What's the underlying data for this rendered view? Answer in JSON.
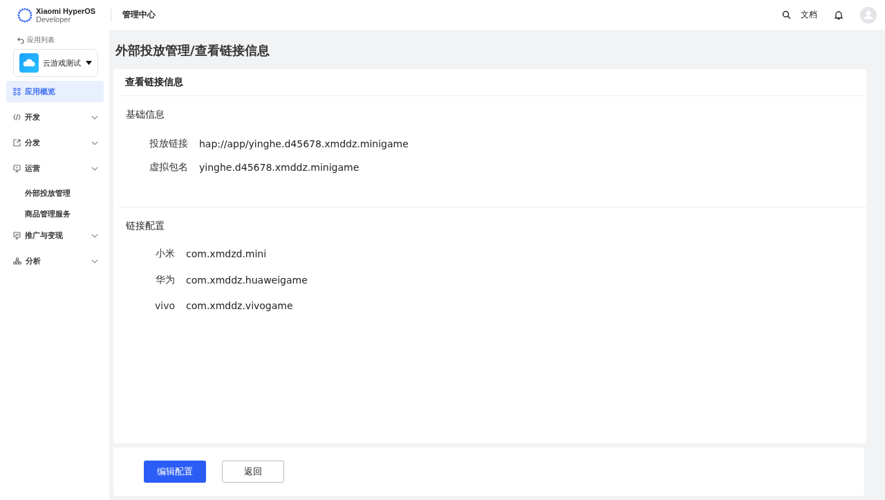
{
  "header": {
    "brand_line1": "Xiaomi HyperOS",
    "brand_line2": "Developer",
    "section": "管理中心",
    "docs_link": "文档"
  },
  "sidebar": {
    "back_link": "应用列表",
    "app_selector": {
      "value": "云游戏测试"
    },
    "items": [
      {
        "label": "应用概览",
        "selected": true
      },
      {
        "label": "开发",
        "selected": false
      },
      {
        "label": "分发",
        "selected": false
      },
      {
        "label": "运营",
        "selected": false,
        "children": [
          {
            "label": "外部投放管理",
            "selected": false
          },
          {
            "label": "商品管理服务",
            "selected": false
          }
        ]
      },
      {
        "label": "推广与变现",
        "selected": false
      },
      {
        "label": "分析",
        "selected": false
      }
    ]
  },
  "page_title": "外部投放管理/查看链接信息",
  "card": {
    "title": "查看链接信息",
    "sections": [
      {
        "heading": "基础信息",
        "fields": [
          {
            "label": "投放链接",
            "value": "hap://app/yinghe.d45678.xmddz.minigame"
          },
          {
            "label": "虚拟包名",
            "value": "yinghe.d45678.xmddz.minigame"
          }
        ]
      },
      {
        "heading": "链接配置",
        "fields": [
          {
            "label": "小米",
            "value": "com.xmdzd.mini"
          },
          {
            "label": "华为",
            "value": "com.xmddz.huaweigame"
          },
          {
            "label": "vivo",
            "value": "com.xmddz.vivogame"
          }
        ]
      }
    ]
  },
  "buttons": [
    {
      "label": "编辑配置",
      "kind": "primary"
    },
    {
      "label": "返回",
      "kind": "secondary"
    }
  ]
}
